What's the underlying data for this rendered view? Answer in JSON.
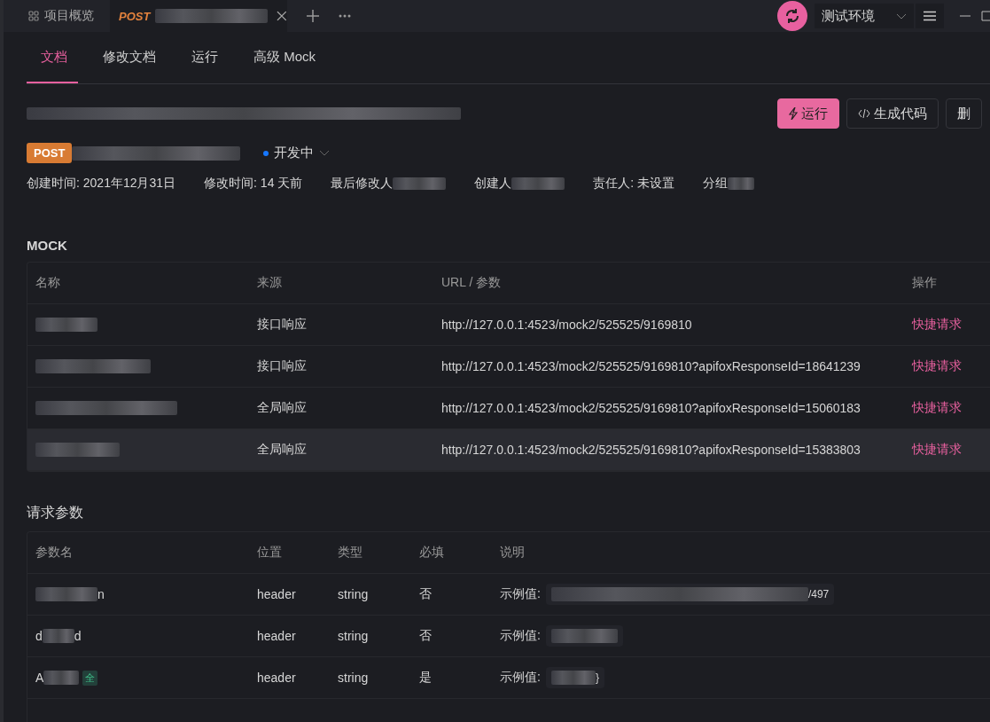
{
  "top_tabs": [
    {
      "kind": "overview",
      "label": "项目概览",
      "selected": false
    },
    {
      "kind": "request",
      "method": "POST",
      "selected": true
    }
  ],
  "environment": {
    "label": "测试环境"
  },
  "doc_tabs": [
    {
      "label": "文档",
      "selected": true
    },
    {
      "label": "修改文档",
      "selected": false
    },
    {
      "label": "运行",
      "selected": false
    },
    {
      "label": "高级 Mock",
      "selected": false
    }
  ],
  "actions": [
    {
      "kind": "primary",
      "label": "运行"
    },
    {
      "kind": "code",
      "label": "生成代码"
    },
    {
      "kind": "plain",
      "label": "删"
    }
  ],
  "method_badge": "POST",
  "status": {
    "label": "开发中",
    "color": "#1677ff"
  },
  "meta": [
    {
      "label": "创建时间: 2021年12月31日"
    },
    {
      "label": "修改时间: 14 天前"
    },
    {
      "label": "最后修改人"
    },
    {
      "label": "创建人"
    },
    {
      "label": "责任人: 未设置"
    },
    {
      "label": "分组"
    }
  ],
  "mock": {
    "title": "MOCK",
    "columns": [
      "名称",
      "来源",
      "URL / 参数",
      "操作"
    ],
    "rows": [
      {
        "source": "接口响应",
        "url": "http://127.0.0.1:4523/mock2/525525/9169810",
        "action": "快捷请求",
        "highlighted": false
      },
      {
        "source": "接口响应",
        "url": "http://127.0.0.1:4523/mock2/525525/9169810?apifoxResponseId=18641239",
        "action": "快捷请求",
        "highlighted": false
      },
      {
        "source": "全局响应",
        "url": "http://127.0.0.1:4523/mock2/525525/9169810?apifoxResponseId=15060183",
        "action": "快捷请求",
        "highlighted": false
      },
      {
        "source": "全局响应",
        "url": "http://127.0.0.1:4523/mock2/525525/9169810?apifoxResponseId=15383803",
        "action": "快捷请求",
        "highlighted": true
      }
    ]
  },
  "params": {
    "title": "请求参数",
    "columns": [
      "参数名",
      "位置",
      "类型",
      "必填",
      "说明"
    ],
    "rows": [
      {
        "name_tail": "n",
        "location": "header",
        "type": "string",
        "required": "否",
        "example_label": "示例值:",
        "example_tail": "/497"
      },
      {
        "name_head": "d",
        "name_tail": "d",
        "location": "header",
        "type": "string",
        "required": "否",
        "example_label": "示例值:"
      },
      {
        "name_head": "A",
        "tag": "全",
        "location": "header",
        "type": "string",
        "required": "是",
        "example_label": "示例值:",
        "example_tail": "}"
      }
    ]
  }
}
